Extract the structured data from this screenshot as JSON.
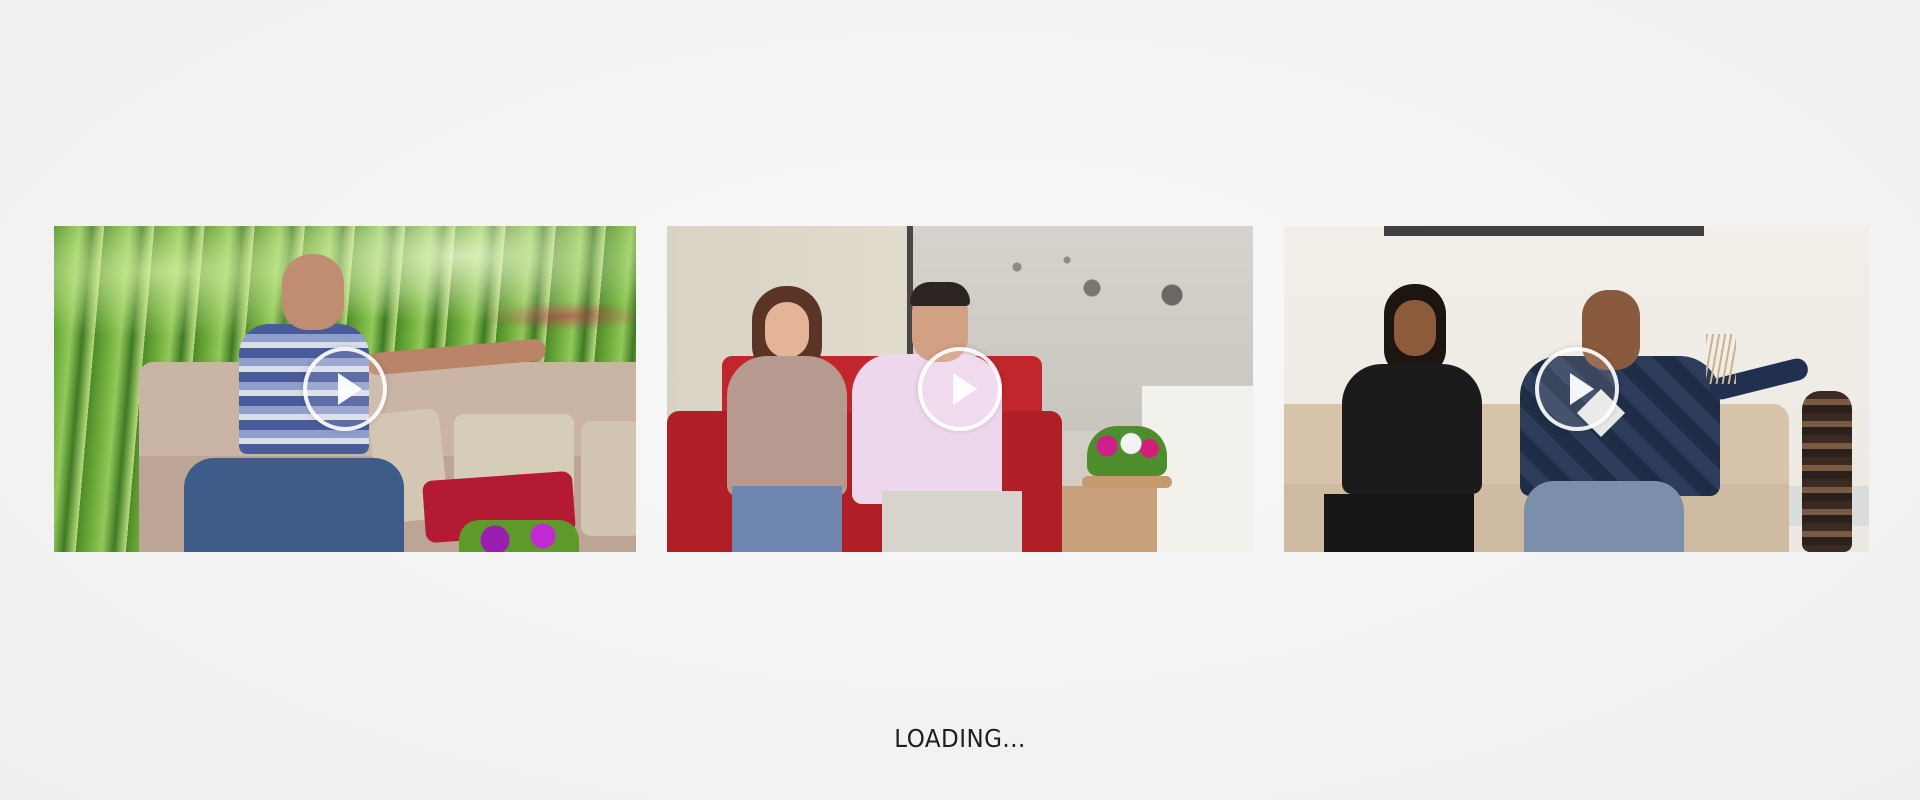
{
  "videos": [
    {
      "id": "video-1",
      "icon": "play-icon"
    },
    {
      "id": "video-2",
      "icon": "play-icon"
    },
    {
      "id": "video-3",
      "icon": "play-icon"
    }
  ],
  "status": {
    "loading_text": "LOADING..."
  },
  "colors": {
    "background": "#f3f3f3",
    "text": "#1e1e1e",
    "play_button": "#ffffff"
  }
}
